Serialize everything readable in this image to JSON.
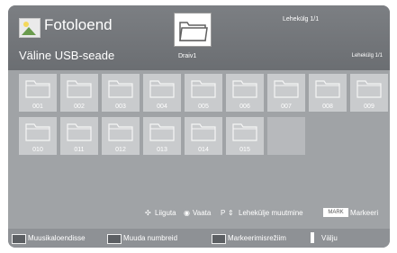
{
  "header": {
    "title": "Fotoloend",
    "device": "Väline USB-seade",
    "drive": "Draiv1",
    "page_top": "Lehekülg 1/1",
    "page_right": "Lehekülg 1/1"
  },
  "folders": [
    "001",
    "002",
    "003",
    "004",
    "005",
    "006",
    "007",
    "008",
    "009",
    "010",
    "011",
    "012",
    "013",
    "014",
    "015"
  ],
  "info": {
    "move": "Liiguta",
    "view": "Vaata",
    "page_prefix": "P",
    "page_change": "Lehekülje muutmine",
    "mark_chip": "MARK",
    "mark": "Markeeri"
  },
  "footer": {
    "music": "Muusikaloendisse",
    "change_number": "Muuda numbreid",
    "mark_mode": "Markeerimisrežiim",
    "exit": "Välju"
  },
  "colors": {
    "tile": "#c9cbcd",
    "background": "#a0a3a6",
    "footer": "#8e9195"
  }
}
